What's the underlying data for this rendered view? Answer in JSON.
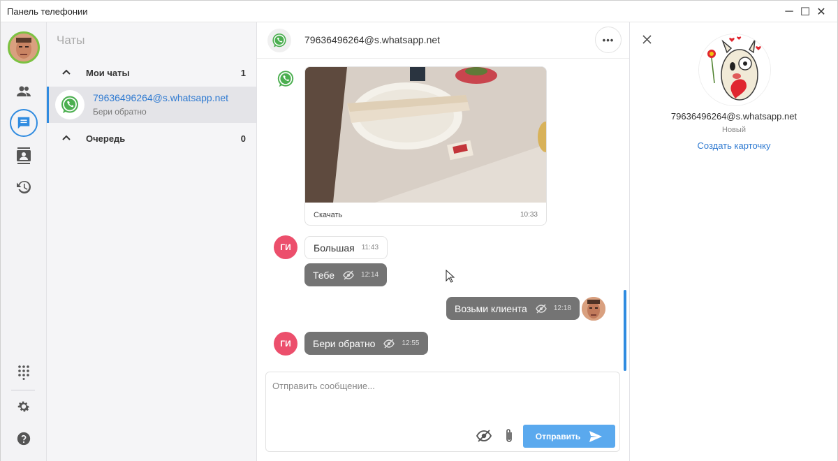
{
  "window": {
    "title": "Панель телефонии",
    "minimize": "─",
    "maximize": "☐",
    "close": "✕"
  },
  "rail": {
    "items": [
      {
        "name": "contacts",
        "icon": "people-icon"
      },
      {
        "name": "chats",
        "icon": "chat-icon",
        "active": true
      },
      {
        "name": "address-book",
        "icon": "contact-book-icon"
      },
      {
        "name": "history",
        "icon": "history-icon"
      }
    ],
    "bottom": [
      {
        "name": "dialpad",
        "icon": "dialpad-icon"
      },
      {
        "name": "settings",
        "icon": "gear-icon"
      },
      {
        "name": "help",
        "icon": "help-icon"
      }
    ]
  },
  "chats_panel": {
    "title": "Чаты",
    "groups": [
      {
        "label": "Мои чаты",
        "count": "1"
      },
      {
        "label": "Очередь",
        "count": "0"
      }
    ],
    "items": [
      {
        "name": "79636496264@s.whatsapp.net",
        "preview": "Бери обратно"
      }
    ]
  },
  "conversation": {
    "contact": "79636496264@s.whatsapp.net",
    "more": "•••",
    "image_message": {
      "download": "Скачать",
      "time": "10:33"
    },
    "messages": [
      {
        "text": "Большая",
        "time": "11:43"
      },
      {
        "text": "Тебе",
        "time": "12:14"
      },
      {
        "text": "Возьми клиента",
        "time": "12:18"
      },
      {
        "text": "Бери обратно",
        "time": "12:55"
      }
    ],
    "sender_initials": "ГИ",
    "composer": {
      "placeholder": "Отправить сообщение...",
      "send_label": "Отправить"
    }
  },
  "details": {
    "name": "79636496264@s.whatsapp.net",
    "status": "Новый",
    "create_card": "Создать карточку"
  },
  "colors": {
    "accent": "#2f8be0",
    "sender_avatar": "#ec4f6c",
    "bubble_dark": "#747474",
    "send_button": "#5aa9ee",
    "status_ring": "#7cc242"
  }
}
